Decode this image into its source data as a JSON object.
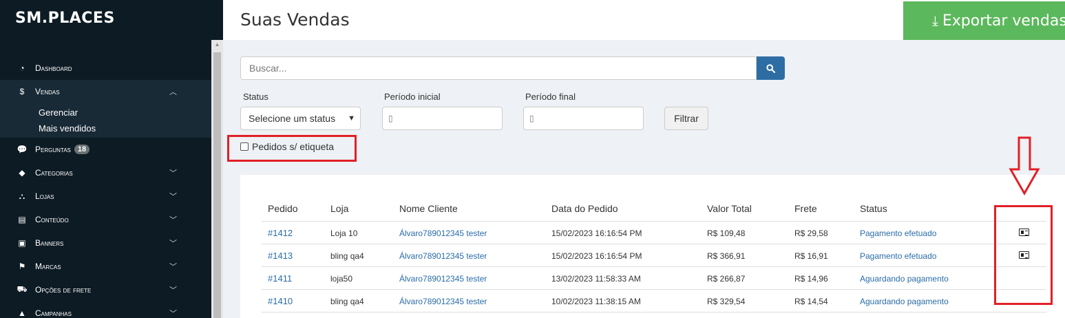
{
  "sidebar": {
    "brand": "SM.PLACES",
    "items": [
      {
        "label": "Dashboard",
        "icon": "dashboard-icon"
      },
      {
        "label": "Vendas",
        "icon": "dollar-icon"
      },
      {
        "label": "Perguntas",
        "icon": "comments-icon",
        "badge": "18"
      },
      {
        "label": "Categorias",
        "icon": "tag-icon"
      },
      {
        "label": "Lojas",
        "icon": "sitemap-icon"
      },
      {
        "label": "Conteúdo",
        "icon": "file-icon"
      },
      {
        "label": "Banners",
        "icon": "image-icon"
      },
      {
        "label": "Marcas",
        "icon": "flag-icon"
      },
      {
        "label": "Opções de frete",
        "icon": "truck-icon"
      },
      {
        "label": "Campanhas",
        "icon": "chart-icon"
      }
    ],
    "vendas_sub": [
      "Gerenciar",
      "Mais vendidos"
    ]
  },
  "header": {
    "title": "Suas Vendas",
    "export_label": "Exportar vendas"
  },
  "filters": {
    "search_placeholder": "Buscar...",
    "status_label": "Status",
    "status_value": "Selecione um status",
    "start_label": "Período inicial",
    "end_label": "Período final",
    "filter_button": "Filtrar",
    "checkbox_label": "Pedidos s/ etiqueta"
  },
  "table": {
    "headers": [
      "Pedido",
      "Loja",
      "Nome Cliente",
      "Data do Pedido",
      "Valor Total",
      "Frete",
      "Status"
    ],
    "rows": [
      {
        "pedido": "#1412",
        "loja": "Loja 10",
        "cliente": "Álvaro789012345 tester",
        "data": "15/02/2023 16:16:54 PM",
        "valor": "R$ 109,48",
        "frete": "R$ 29,58",
        "status": "Pagamento efetuado",
        "has_label_icon": true
      },
      {
        "pedido": "#1413",
        "loja": "bling qa4",
        "cliente": "Álvaro789012345 tester",
        "data": "15/02/2023 16:16:54 PM",
        "valor": "R$ 366,91",
        "frete": "R$ 16,91",
        "status": "Pagamento efetuado",
        "has_label_icon": true
      },
      {
        "pedido": "#1411",
        "loja": "loja50",
        "cliente": "Álvaro789012345 tester",
        "data": "13/02/2023 11:58:33 AM",
        "valor": "R$ 266,87",
        "frete": "R$ 14,96",
        "status": "Aguardando pagamento",
        "has_label_icon": false
      },
      {
        "pedido": "#1410",
        "loja": "bling qa4",
        "cliente": "Álvaro789012345 tester",
        "data": "10/02/2023 11:38:15 AM",
        "valor": "R$ 329,54",
        "frete": "R$ 14,54",
        "status": "Aguardando pagamento",
        "has_label_icon": false
      }
    ]
  },
  "colors": {
    "sidebar_bg": "#0d1b24",
    "export_green": "#5cb85c",
    "search_blue": "#2e6da4",
    "link_blue": "#2a6ca8",
    "annotation_red": "#e21f26"
  }
}
